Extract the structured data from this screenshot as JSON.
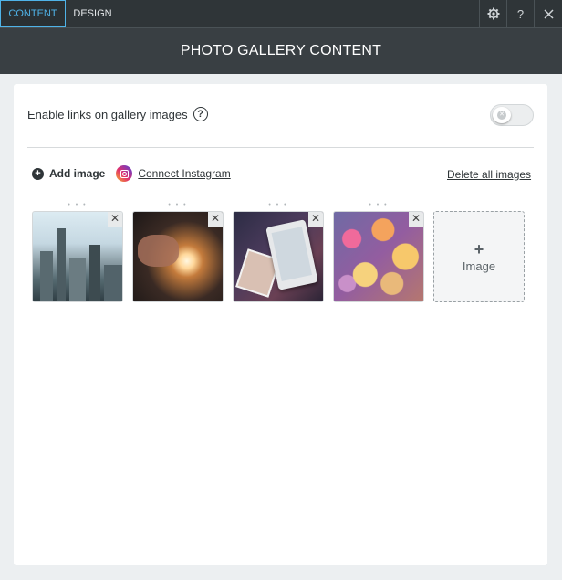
{
  "tabs": [
    {
      "label": "CONTENT",
      "active": true
    },
    {
      "label": "DESIGN",
      "active": false
    }
  ],
  "toolbar": {
    "settings_icon": "gear-icon",
    "help_label": "?",
    "close_icon": "close-icon"
  },
  "header": {
    "title": "PHOTO GALLERY CONTENT"
  },
  "settings": {
    "links_label": "Enable links on gallery images",
    "links_enabled": false
  },
  "actions": {
    "add_image_label": "Add image",
    "connect_instagram_label": "Connect Instagram",
    "delete_all_label": "Delete all images"
  },
  "gallery": {
    "images": [
      {
        "name": "city skyline photo"
      },
      {
        "name": "sparkler photo"
      },
      {
        "name": "tablet photo"
      },
      {
        "name": "bokeh lights photo"
      }
    ],
    "add_slot_label": "Image"
  },
  "colors": {
    "accent": "#4fb3e8",
    "topbar": "#2f3538",
    "header": "#393f43"
  }
}
